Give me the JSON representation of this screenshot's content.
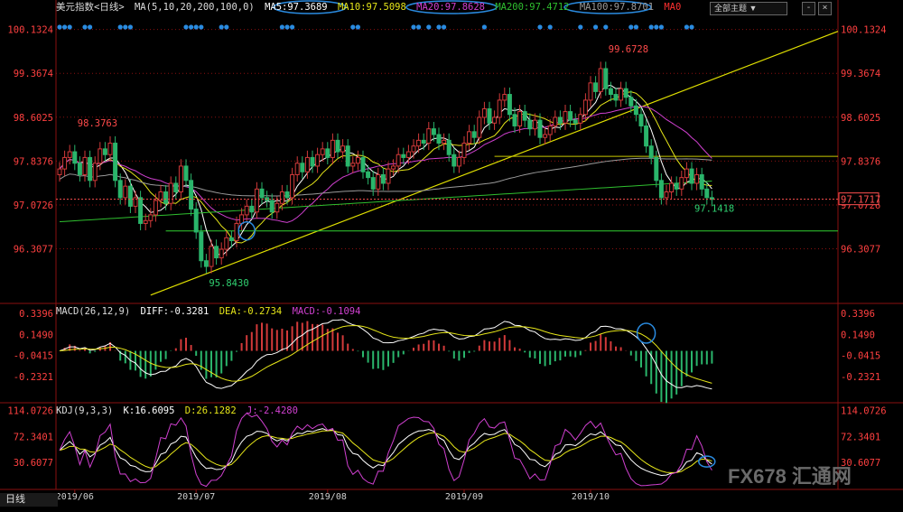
{
  "toolbar": {
    "view_selector": "全部主题 ▼",
    "min_btn": "-",
    "close_btn": "×",
    "timeframe": "日线"
  },
  "watermark": "FX678 汇通网",
  "colors": {
    "up": "#d23a3a",
    "down": "#2ab56b",
    "ma5": "#ffffff",
    "ma10": "#e6e619",
    "ma20": "#d040d0",
    "ma200": "#2fbf2f",
    "ma100": "#9a9a9a",
    "trend": "#e0e000",
    "support": "#30d030",
    "grid": "#8a1010",
    "price": "#ff4040"
  },
  "chart_data": {
    "type": "candlestick",
    "instrument": "美元指数",
    "period": "日线",
    "header": {
      "title": "美元指数<日线>",
      "ma_params": "MA(5,10,20,200,100,0)",
      "values": [
        {
          "label": "MA5:97.3689",
          "color": "#ffffff"
        },
        {
          "label": "MA10:97.5098",
          "color": "#e6e619"
        },
        {
          "label": "MA20:97.8628",
          "color": "#d040d0"
        },
        {
          "label": "MA200:97.4712",
          "color": "#2fbf2f"
        },
        {
          "label": "MA100:97.8701",
          "color": "#9a9a9a"
        },
        {
          "label": "MA0",
          "color": "#ff3030"
        }
      ]
    },
    "y_ticks": [
      {
        "value": 100.1324,
        "label": "100.1324"
      },
      {
        "value": 99.3674,
        "label": "99.3674"
      },
      {
        "value": 98.6025,
        "label": "98.6025"
      },
      {
        "value": 97.8376,
        "label": "97.8376"
      },
      {
        "value": 97.0726,
        "label": "97.0726"
      },
      {
        "value": 96.3077,
        "label": "96.3077"
      }
    ],
    "ylim": [
      95.45,
      100.3
    ],
    "last_price": {
      "value": 97.1717,
      "label": "97.1717"
    },
    "x_ticks": [
      "2019/06",
      "2019/07",
      "2019/08",
      "2019/09",
      "2019/10"
    ],
    "x_tick_index": [
      3,
      27,
      53,
      80,
      105
    ],
    "annotations": [
      {
        "label": "98.3763",
        "value": 98.3763,
        "index": 3,
        "kind": "high"
      },
      {
        "label": "95.8430",
        "value": 95.843,
        "index": 29,
        "kind": "low"
      },
      {
        "label": "99.6728",
        "value": 99.6728,
        "index": 108,
        "kind": "high"
      },
      {
        "label": "97.1418",
        "value": 97.1418,
        "index": 125,
        "kind": "low"
      }
    ],
    "closes": [
      97.7,
      97.9,
      98.0,
      97.8,
      97.6,
      97.9,
      97.5,
      97.8,
      98.05,
      97.95,
      98.15,
      97.5,
      97.2,
      97.4,
      97.05,
      97.2,
      96.75,
      96.8,
      96.9,
      97.15,
      97.3,
      97.1,
      97.45,
      97.3,
      97.75,
      97.5,
      97.0,
      96.6,
      96.1,
      96.0,
      96.35,
      96.15,
      96.3,
      96.5,
      96.45,
      96.75,
      96.9,
      97.05,
      96.95,
      97.35,
      97.2,
      97.15,
      96.95,
      97.1,
      97.3,
      97.2,
      97.6,
      97.8,
      97.65,
      97.9,
      97.75,
      97.95,
      98.05,
      97.9,
      98.2,
      98.0,
      98.1,
      97.75,
      97.8,
      97.9,
      97.65,
      97.55,
      97.35,
      97.6,
      97.45,
      97.7,
      97.75,
      97.95,
      97.9,
      98.0,
      98.1,
      98.2,
      98.15,
      98.4,
      98.3,
      98.15,
      98.2,
      97.95,
      97.75,
      97.9,
      98.15,
      98.35,
      98.25,
      98.6,
      98.75,
      98.5,
      98.6,
      98.9,
      99.0,
      98.65,
      98.45,
      98.7,
      98.55,
      98.4,
      98.55,
      98.25,
      98.3,
      98.45,
      98.6,
      98.5,
      98.7,
      98.55,
      98.5,
      98.65,
      98.9,
      99.2,
      99.05,
      99.45,
      99.1,
      99.0,
      98.9,
      99.1,
      98.95,
      98.8,
      98.65,
      98.45,
      98.1,
      97.9,
      97.5,
      97.2,
      97.3,
      97.45,
      97.35,
      97.55,
      97.7,
      97.45,
      97.6,
      97.35,
      97.2,
      97.17
    ],
    "macd": {
      "label": "MACD(26,12,9)",
      "diff_label": "DIFF:-0.3281",
      "dea_label": "DEA:-0.2734",
      "macd_label": "MACD:-0.1094",
      "y_ticks": [
        {
          "value": 0.3396,
          "label": "0.3396"
        },
        {
          "value": 0.149,
          "label": "0.1490"
        },
        {
          "value": -0.0415,
          "label": "-0.0415"
        },
        {
          "value": -0.2321,
          "label": "-0.2321"
        }
      ],
      "ylim": [
        -0.42,
        0.38
      ]
    },
    "kdj": {
      "label": "KDJ(9,3,3)",
      "k_label": "K:16.6095",
      "d_label": "D:26.1282",
      "j_label": "J:-2.4280",
      "y_ticks": [
        {
          "value": 114.0726,
          "label": "114.0726"
        },
        {
          "value": 72.3401,
          "label": "72.3401"
        },
        {
          "value": 30.6077,
          "label": "30.6077"
        }
      ],
      "ylim": [
        -10,
        118
      ]
    }
  }
}
